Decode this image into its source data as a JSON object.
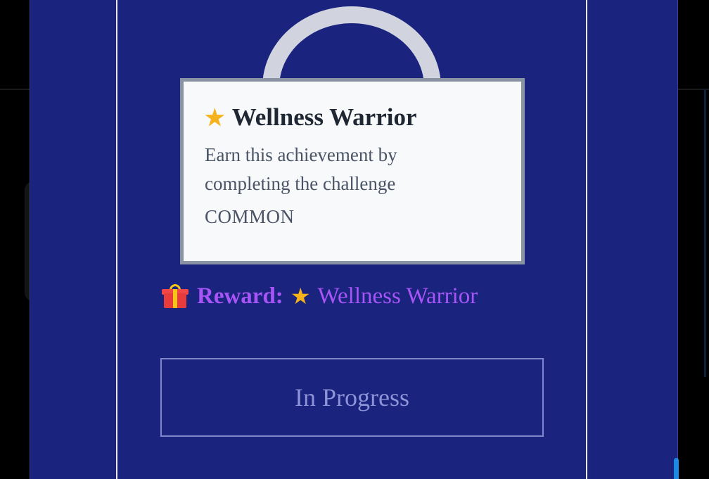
{
  "tooltip": {
    "title": "Wellness Warrior",
    "title_icon": "star-icon",
    "description": "Earn this achievement by completing the challenge",
    "rarity": "COMMON"
  },
  "reward": {
    "icon": "gift-icon",
    "label": "Reward:",
    "value_icon": "star-icon",
    "value": "Wellness Warrior"
  },
  "status_button": {
    "label": "In Progress"
  },
  "colors": {
    "overlay_background": "#1a237e",
    "card_border": "#e8eaf6",
    "reward_accent": "#a855f7",
    "button_text": "#8c93d6",
    "tooltip_background": "#f7f9fb",
    "scroll_thumb": "#1e88e5"
  }
}
